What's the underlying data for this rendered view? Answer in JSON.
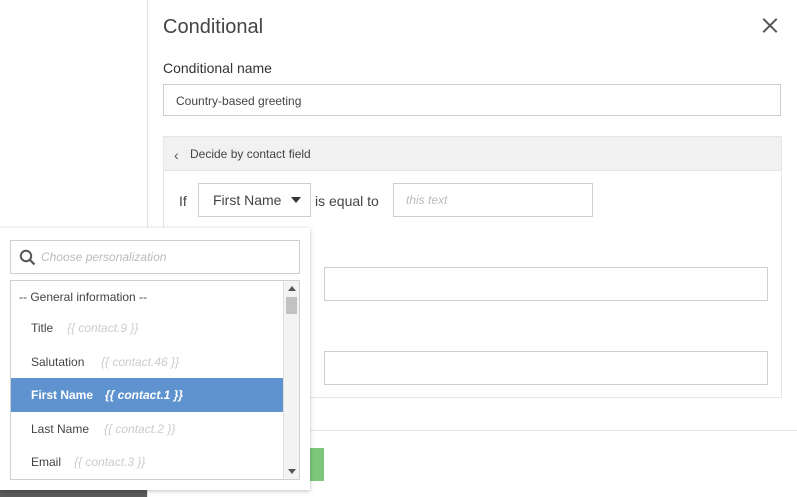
{
  "dialog": {
    "title": "Conditional",
    "name_label": "Conditional name",
    "name_value": "Country-based greeting",
    "panel_header": "Decide by contact field",
    "condition": {
      "if_label": "If",
      "field": "First Name",
      "operator": "is equal to",
      "value_placeholder": "this text"
    }
  },
  "dropdown": {
    "search_placeholder": "Choose personalization",
    "group": "-- General information --",
    "items": [
      {
        "name": "Title",
        "token": "{{ contact.9 }}"
      },
      {
        "name": "Salutation",
        "token": "{{ contact.46 }}"
      },
      {
        "name": "First Name",
        "token": "{{ contact.1 }}"
      },
      {
        "name": "Last Name",
        "token": "{{ contact.2 }}"
      },
      {
        "name": "Email",
        "token": "{{ contact.3 }}"
      }
    ],
    "selected_index": 2
  },
  "colors": {
    "selected_bg": "#5f93cf",
    "save_button": "#7cc77a"
  }
}
